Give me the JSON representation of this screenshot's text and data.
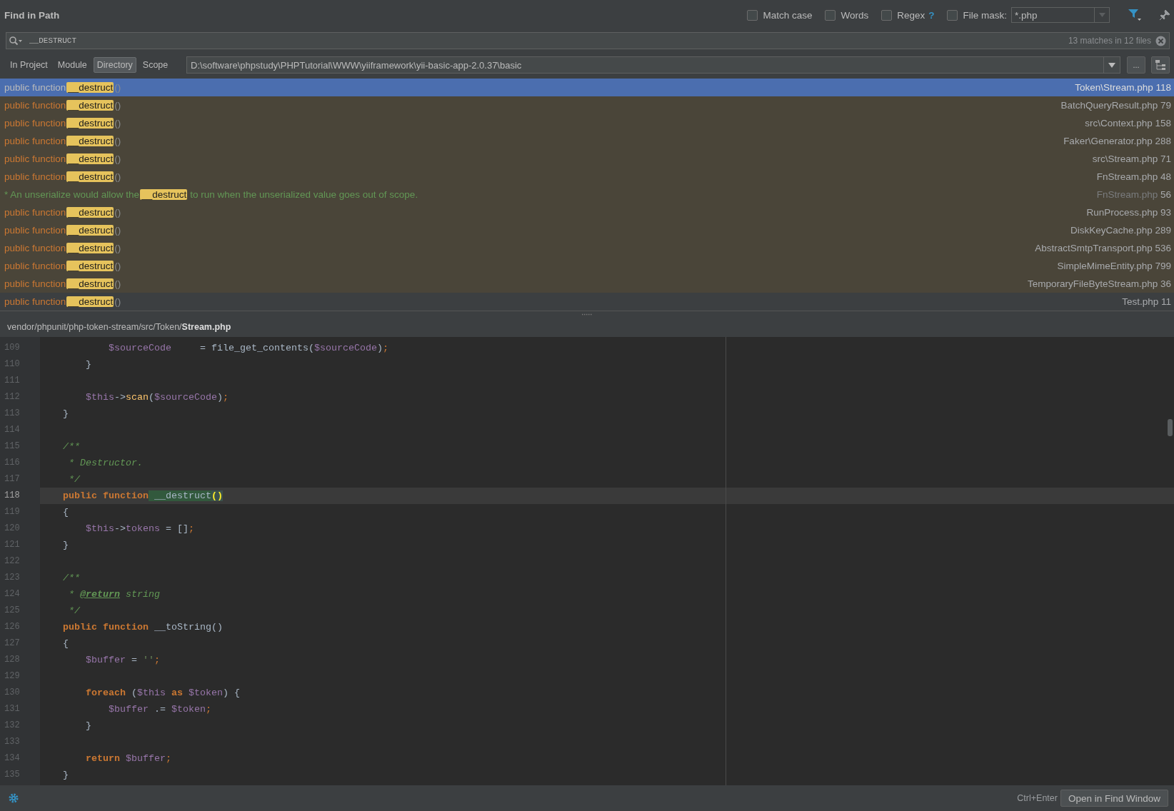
{
  "title": "Find in Path",
  "options": [
    {
      "label": "Match case",
      "checked": false
    },
    {
      "label": "Words",
      "checked": false
    },
    {
      "label": "Regex",
      "checked": false,
      "help": "?"
    }
  ],
  "file_mask": {
    "label": "File mask:",
    "checked": false,
    "value": "*.php",
    "disabled": true
  },
  "search": {
    "value": "__DESTRUCT",
    "summary": "13 matches in 12 files"
  },
  "scopes": [
    {
      "label": "In Project",
      "selected": false
    },
    {
      "label": "Module",
      "selected": false
    },
    {
      "label": "Directory",
      "selected": true
    },
    {
      "label": "Scope",
      "selected": false
    }
  ],
  "directory": {
    "value": "D:\\software\\phpstudy\\PHPTutorial\\WWW\\yiiframework\\yii-basic-app-2.0.37\\basic",
    "browse": "..."
  },
  "results": [
    {
      "kind": "code",
      "prefix": "public function",
      "match": "__destruct",
      "suffix": "()",
      "file": "Token\\Stream.php",
      "line": "118",
      "selected": true,
      "library": true,
      "repeated": false
    },
    {
      "kind": "code",
      "prefix": "public function",
      "match": "__destruct",
      "suffix": "()",
      "file": "BatchQueryResult.php",
      "line": "79",
      "selected": false,
      "library": true,
      "repeated": false
    },
    {
      "kind": "code",
      "prefix": "public function",
      "match": "__destruct",
      "suffix": "()",
      "file": "src\\Context.php",
      "line": "158",
      "selected": false,
      "library": true,
      "repeated": false
    },
    {
      "kind": "code",
      "prefix": "public function",
      "match": "__destruct",
      "suffix": "()",
      "file": "Faker\\Generator.php",
      "line": "288",
      "selected": false,
      "library": true,
      "repeated": false
    },
    {
      "kind": "code",
      "prefix": "public function",
      "match": "__destruct",
      "suffix": "()",
      "file": "src\\Stream.php",
      "line": "71",
      "selected": false,
      "library": true,
      "repeated": false
    },
    {
      "kind": "code",
      "prefix": "public function",
      "match": "__destruct",
      "suffix": "()",
      "file": "FnStream.php",
      "line": "48",
      "selected": false,
      "library": true,
      "repeated": false
    },
    {
      "kind": "comment",
      "prefix": "* An unserialize would allow the",
      "match": "__destruct",
      "suffix": "to run when the unserialized value goes out of scope.",
      "file": "FnStream.php",
      "line": "56",
      "selected": false,
      "library": true,
      "repeated": true
    },
    {
      "kind": "code",
      "prefix": "public function",
      "match": "__destruct",
      "suffix": "()",
      "file": "RunProcess.php",
      "line": "93",
      "selected": false,
      "library": true,
      "repeated": false
    },
    {
      "kind": "code",
      "prefix": "public function",
      "match": "__destruct",
      "suffix": "()",
      "file": "DiskKeyCache.php",
      "line": "289",
      "selected": false,
      "library": true,
      "repeated": false
    },
    {
      "kind": "code",
      "prefix": "public function",
      "match": "__destruct",
      "suffix": "()",
      "file": "AbstractSmtpTransport.php",
      "line": "536",
      "selected": false,
      "library": true,
      "repeated": false
    },
    {
      "kind": "code",
      "prefix": "public function",
      "match": "__destruct",
      "suffix": "()",
      "file": "SimpleMimeEntity.php",
      "line": "799",
      "selected": false,
      "library": true,
      "repeated": false
    },
    {
      "kind": "code",
      "prefix": "public function",
      "match": "__destruct",
      "suffix": "()",
      "file": "TemporaryFileByteStream.php",
      "line": "36",
      "selected": false,
      "library": true,
      "repeated": false
    },
    {
      "kind": "code",
      "prefix": "public function",
      "match": "__destruct",
      "suffix": "()",
      "file": "Test.php",
      "line": "11",
      "selected": false,
      "library": false,
      "repeated": false
    }
  ],
  "preview_path": "vendor/phpunit/php-token-stream/src/Token/**Stream.php**",
  "code": [
    {
      "number": "109",
      "current": false,
      "tokens": [
        {
          "kind": "var",
          "text": "            $sourceCode"
        },
        {
          "kind": "plain",
          "text": "     = file_get_contents("
        },
        {
          "kind": "var",
          "text": "$sourceCode"
        },
        {
          "kind": "plain",
          "text": ")"
        },
        {
          "kind": "punct",
          "text": ";"
        }
      ]
    },
    {
      "number": "110",
      "current": false,
      "tokens": [
        {
          "kind": "plain",
          "text": "        }"
        }
      ]
    },
    {
      "number": "111",
      "current": false
    },
    {
      "number": "112",
      "current": false,
      "tokens": [
        {
          "kind": "var",
          "text": "        $this"
        },
        {
          "kind": "plain",
          "text": "->"
        },
        {
          "kind": "fn",
          "text": "scan"
        },
        {
          "kind": "plain",
          "text": "("
        },
        {
          "kind": "var",
          "text": "$sourceCode"
        },
        {
          "kind": "plain",
          "text": ")"
        },
        {
          "kind": "punct",
          "text": ";"
        }
      ]
    },
    {
      "number": "113",
      "current": false,
      "tokens": [
        {
          "kind": "plain",
          "text": "    }"
        }
      ]
    },
    {
      "number": "114",
      "current": false
    },
    {
      "number": "115",
      "current": false,
      "tokens": [
        {
          "kind": "comment",
          "text": "    /**"
        }
      ]
    },
    {
      "number": "116",
      "current": false,
      "tokens": [
        {
          "kind": "comment",
          "text": "     * Destructor."
        }
      ]
    },
    {
      "number": "117",
      "current": false,
      "tokens": [
        {
          "kind": "comment",
          "text": "     */"
        }
      ]
    },
    {
      "number": "118",
      "current": true,
      "tokens": [
        {
          "kind": "kw",
          "text": "    public function"
        },
        {
          "kind": "match",
          "text": " __destruct"
        },
        {
          "kind": "brace",
          "text": "()"
        }
      ]
    },
    {
      "number": "119",
      "current": false,
      "tokens": [
        {
          "kind": "plain",
          "text": "    {"
        }
      ]
    },
    {
      "number": "120",
      "current": false,
      "tokens": [
        {
          "kind": "var",
          "text": "        $this"
        },
        {
          "kind": "plain",
          "text": "->"
        },
        {
          "kind": "var",
          "text": "tokens"
        },
        {
          "kind": "plain",
          "text": " = []"
        },
        {
          "kind": "punct",
          "text": ";"
        }
      ]
    },
    {
      "number": "121",
      "current": false,
      "tokens": [
        {
          "kind": "plain",
          "text": "    }"
        }
      ]
    },
    {
      "number": "122",
      "current": false
    },
    {
      "number": "123",
      "current": false,
      "tokens": [
        {
          "kind": "comment",
          "text": "    /**"
        }
      ]
    },
    {
      "number": "124",
      "current": false,
      "tokens": [
        {
          "kind": "comment",
          "text": "     * "
        },
        {
          "kind": "doctag",
          "text": "@return"
        },
        {
          "kind": "comment",
          "text": " string"
        }
      ]
    },
    {
      "number": "125",
      "current": false,
      "tokens": [
        {
          "kind": "comment",
          "text": "     */"
        }
      ]
    },
    {
      "number": "126",
      "current": false,
      "tokens": [
        {
          "kind": "kw",
          "text": "    public function"
        },
        {
          "kind": "plain",
          "text": " __toString()"
        }
      ]
    },
    {
      "number": "127",
      "current": false,
      "tokens": [
        {
          "kind": "plain",
          "text": "    {"
        }
      ]
    },
    {
      "number": "128",
      "current": false,
      "tokens": [
        {
          "kind": "var",
          "text": "        $buffer"
        },
        {
          "kind": "plain",
          "text": " = "
        },
        {
          "kind": "string",
          "text": "''"
        },
        {
          "kind": "punct",
          "text": ";"
        }
      ]
    },
    {
      "number": "129",
      "current": false
    },
    {
      "number": "130",
      "current": false,
      "tokens": [
        {
          "kind": "kw",
          "text": "        foreach"
        },
        {
          "kind": "plain",
          "text": " ("
        },
        {
          "kind": "var",
          "text": "$this"
        },
        {
          "kind": "kw",
          "text": " as "
        },
        {
          "kind": "var",
          "text": "$token"
        },
        {
          "kind": "plain",
          "text": ") {"
        }
      ]
    },
    {
      "number": "131",
      "current": false,
      "tokens": [
        {
          "kind": "var",
          "text": "            $buffer"
        },
        {
          "kind": "plain",
          "text": " .= "
        },
        {
          "kind": "var",
          "text": "$token"
        },
        {
          "kind": "punct",
          "text": ";"
        }
      ]
    },
    {
      "number": "132",
      "current": false,
      "tokens": [
        {
          "kind": "plain",
          "text": "        }"
        }
      ]
    },
    {
      "number": "133",
      "current": false
    },
    {
      "number": "134",
      "current": false,
      "tokens": [
        {
          "kind": "kw",
          "text": "        return "
        },
        {
          "kind": "var",
          "text": "$buffer"
        },
        {
          "kind": "punct",
          "text": ";"
        }
      ]
    },
    {
      "number": "135",
      "current": false,
      "tokens": [
        {
          "kind": "plain",
          "text": "    }"
        }
      ]
    }
  ],
  "shortcut": "Ctrl+Enter",
  "open_button": "Open in Find Window"
}
